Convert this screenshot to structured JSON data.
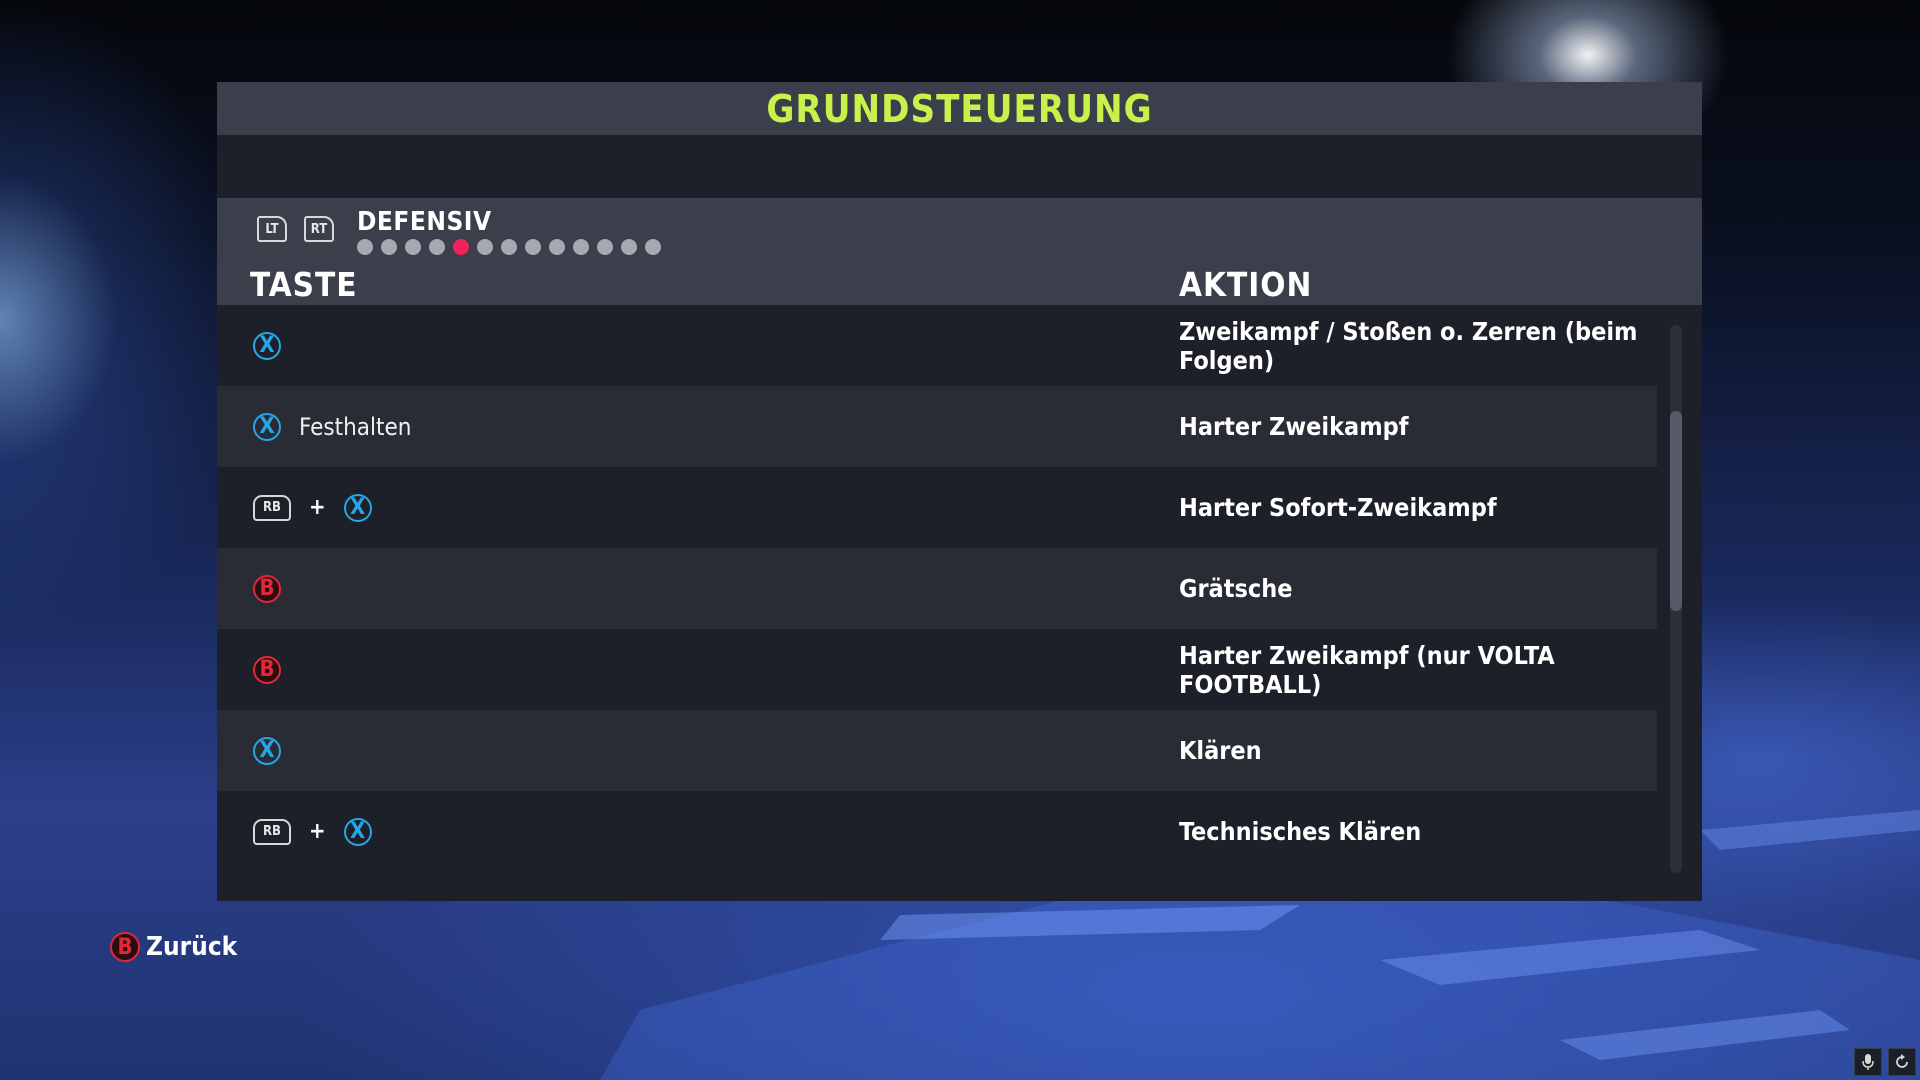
{
  "screen": {
    "title": "GRUNDSTEUERUNG",
    "left_bumper": "LT",
    "right_bumper": "RT",
    "category": "DEFENSIV",
    "page_count": 13,
    "active_page": 5,
    "column_key": "TASTE",
    "column_action": "AKTION"
  },
  "rows": [
    {
      "keys": [
        "X"
      ],
      "key_label": "",
      "action": "Zweikampf / Stoßen o. Zerren (beim Folgen)"
    },
    {
      "keys": [
        "X"
      ],
      "key_label": "Festhalten",
      "action": "Harter Zweikampf"
    },
    {
      "keys": [
        "RB",
        "+",
        "X"
      ],
      "key_label": "",
      "action": "Harter Sofort-Zweikampf"
    },
    {
      "keys": [
        "B"
      ],
      "key_label": "",
      "action": "Grätsche"
    },
    {
      "keys": [
        "B"
      ],
      "key_label": "",
      "action": "Harter Zweikampf (nur VOLTA FOOTBALL)"
    },
    {
      "keys": [
        "X"
      ],
      "key_label": "",
      "action": "Klären"
    },
    {
      "keys": [
        "RB",
        "+",
        "X"
      ],
      "key_label": "",
      "action": "Technisches Klären"
    }
  ],
  "footer": {
    "back_button": "B",
    "back_label": "Zurück"
  },
  "system_icons": [
    "microphone-icon",
    "refresh-icon"
  ],
  "colors": {
    "title": "#c8f24a",
    "x_button": "#27a6e5",
    "b_button": "#e0283a",
    "active_dot": "#f0245a"
  }
}
